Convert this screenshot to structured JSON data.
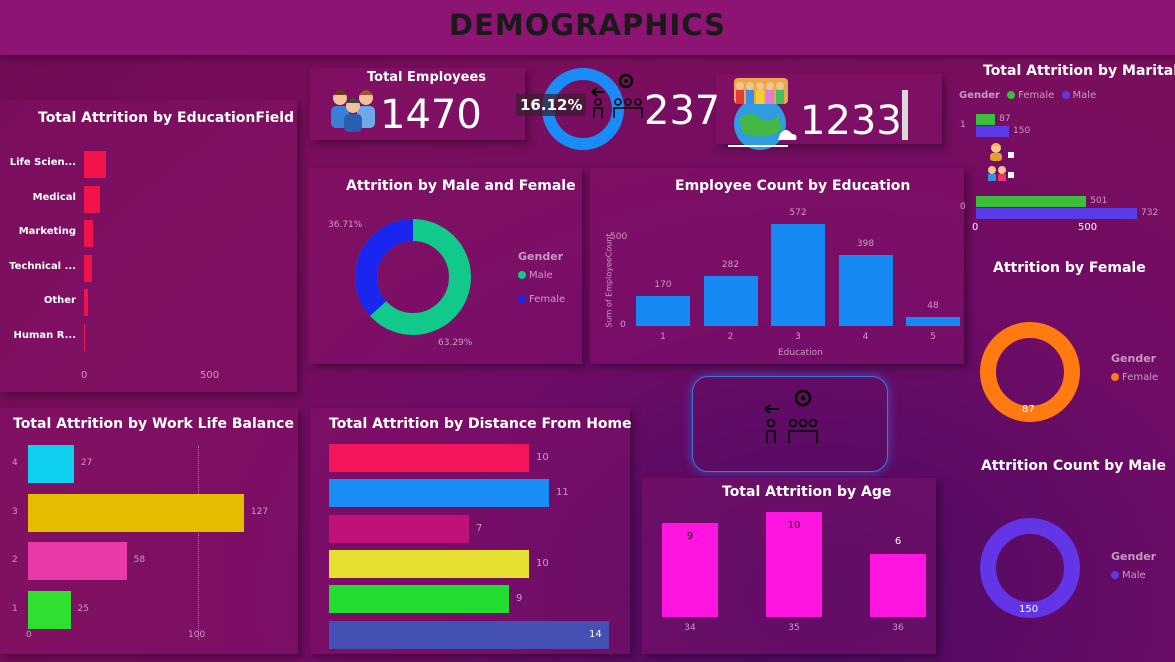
{
  "header": {
    "title": "DEMOGRAPHICS"
  },
  "kpi": {
    "total_employees_title": "Total Employees",
    "total_employees": "1470",
    "attrition_pct": "16.12%",
    "attrition_count": "237",
    "active_count": "1233"
  },
  "edu_field": {
    "title": "Total Attrition by EducationField",
    "categories": [
      "Life Scien...",
      "Medical",
      "Marketing",
      "Technical ...",
      "Other",
      "Human R..."
    ],
    "values": [
      89,
      63,
      35,
      32,
      17,
      6
    ],
    "ticks": [
      "0",
      "500"
    ],
    "color": "#f0144a"
  },
  "gender_donut": {
    "title": "Attrition by Male and Female",
    "legend_title": "Gender",
    "legend": [
      "Male",
      "Female"
    ],
    "pct_female": "36.71%",
    "pct_male": "63.29%",
    "colors": [
      "#10c98a",
      "#1a26f0"
    ]
  },
  "edu_count": {
    "title": "Employee Count by Education",
    "ylabel": "Sum of EmployeeCount",
    "xlabel": "Education",
    "yticks": [
      "0",
      "500"
    ],
    "categories": [
      "1",
      "2",
      "3",
      "4",
      "5"
    ],
    "values": [
      170,
      282,
      572,
      398,
      48
    ],
    "labels": [
      "170",
      "282",
      "572",
      "398",
      "48"
    ],
    "color": "#1689f5"
  },
  "marital": {
    "title": "Total Attrition by Marital",
    "legend_title": "Gender",
    "legend": [
      "Female",
      "Male"
    ],
    "groups": [
      "1",
      "0"
    ],
    "female_values": [
      87,
      501
    ],
    "male_values": [
      150,
      732
    ],
    "female_labels": [
      "87",
      "501"
    ],
    "male_labels": [
      "150",
      "732"
    ],
    "ticks": [
      "0",
      "500"
    ],
    "colors": [
      "#3bbf38",
      "#5b3be8"
    ]
  },
  "female_donut": {
    "title": "Attrition by Female",
    "legend_title": "Gender",
    "legend": "Female",
    "value": "87",
    "color": "#ff7a10"
  },
  "male_donut": {
    "title": "Attrition Count by Male",
    "legend_title": "Gender",
    "legend": "Male",
    "value": "150",
    "color": "#6236e6"
  },
  "wlb": {
    "title": "Total Attrition by Work Life Balance",
    "categories": [
      "4",
      "3",
      "2",
      "1"
    ],
    "values": [
      27,
      127,
      58,
      25
    ],
    "labels": [
      "27",
      "127",
      "58",
      "25"
    ],
    "colors": [
      "#10d0f0",
      "#e5bc00",
      "#e83aa8",
      "#30e030"
    ],
    "ticks": [
      "0",
      "100"
    ]
  },
  "distance": {
    "title": "Total Attrition by Distance From Home",
    "values": [
      10,
      11,
      7,
      10,
      9,
      14
    ],
    "labels": [
      "10",
      "11",
      "7",
      "10",
      "9",
      "14"
    ],
    "colors": [
      "#f5155a",
      "#1a8cf5",
      "#c0107a",
      "#e5e030",
      "#22dd30",
      "#4550b5"
    ]
  },
  "age": {
    "title": "Total Attrition by Age",
    "categories": [
      "34",
      "35",
      "36"
    ],
    "values": [
      9,
      10,
      6
    ],
    "labels": [
      "9",
      "10",
      "6"
    ],
    "color": "#ff14e0"
  }
}
